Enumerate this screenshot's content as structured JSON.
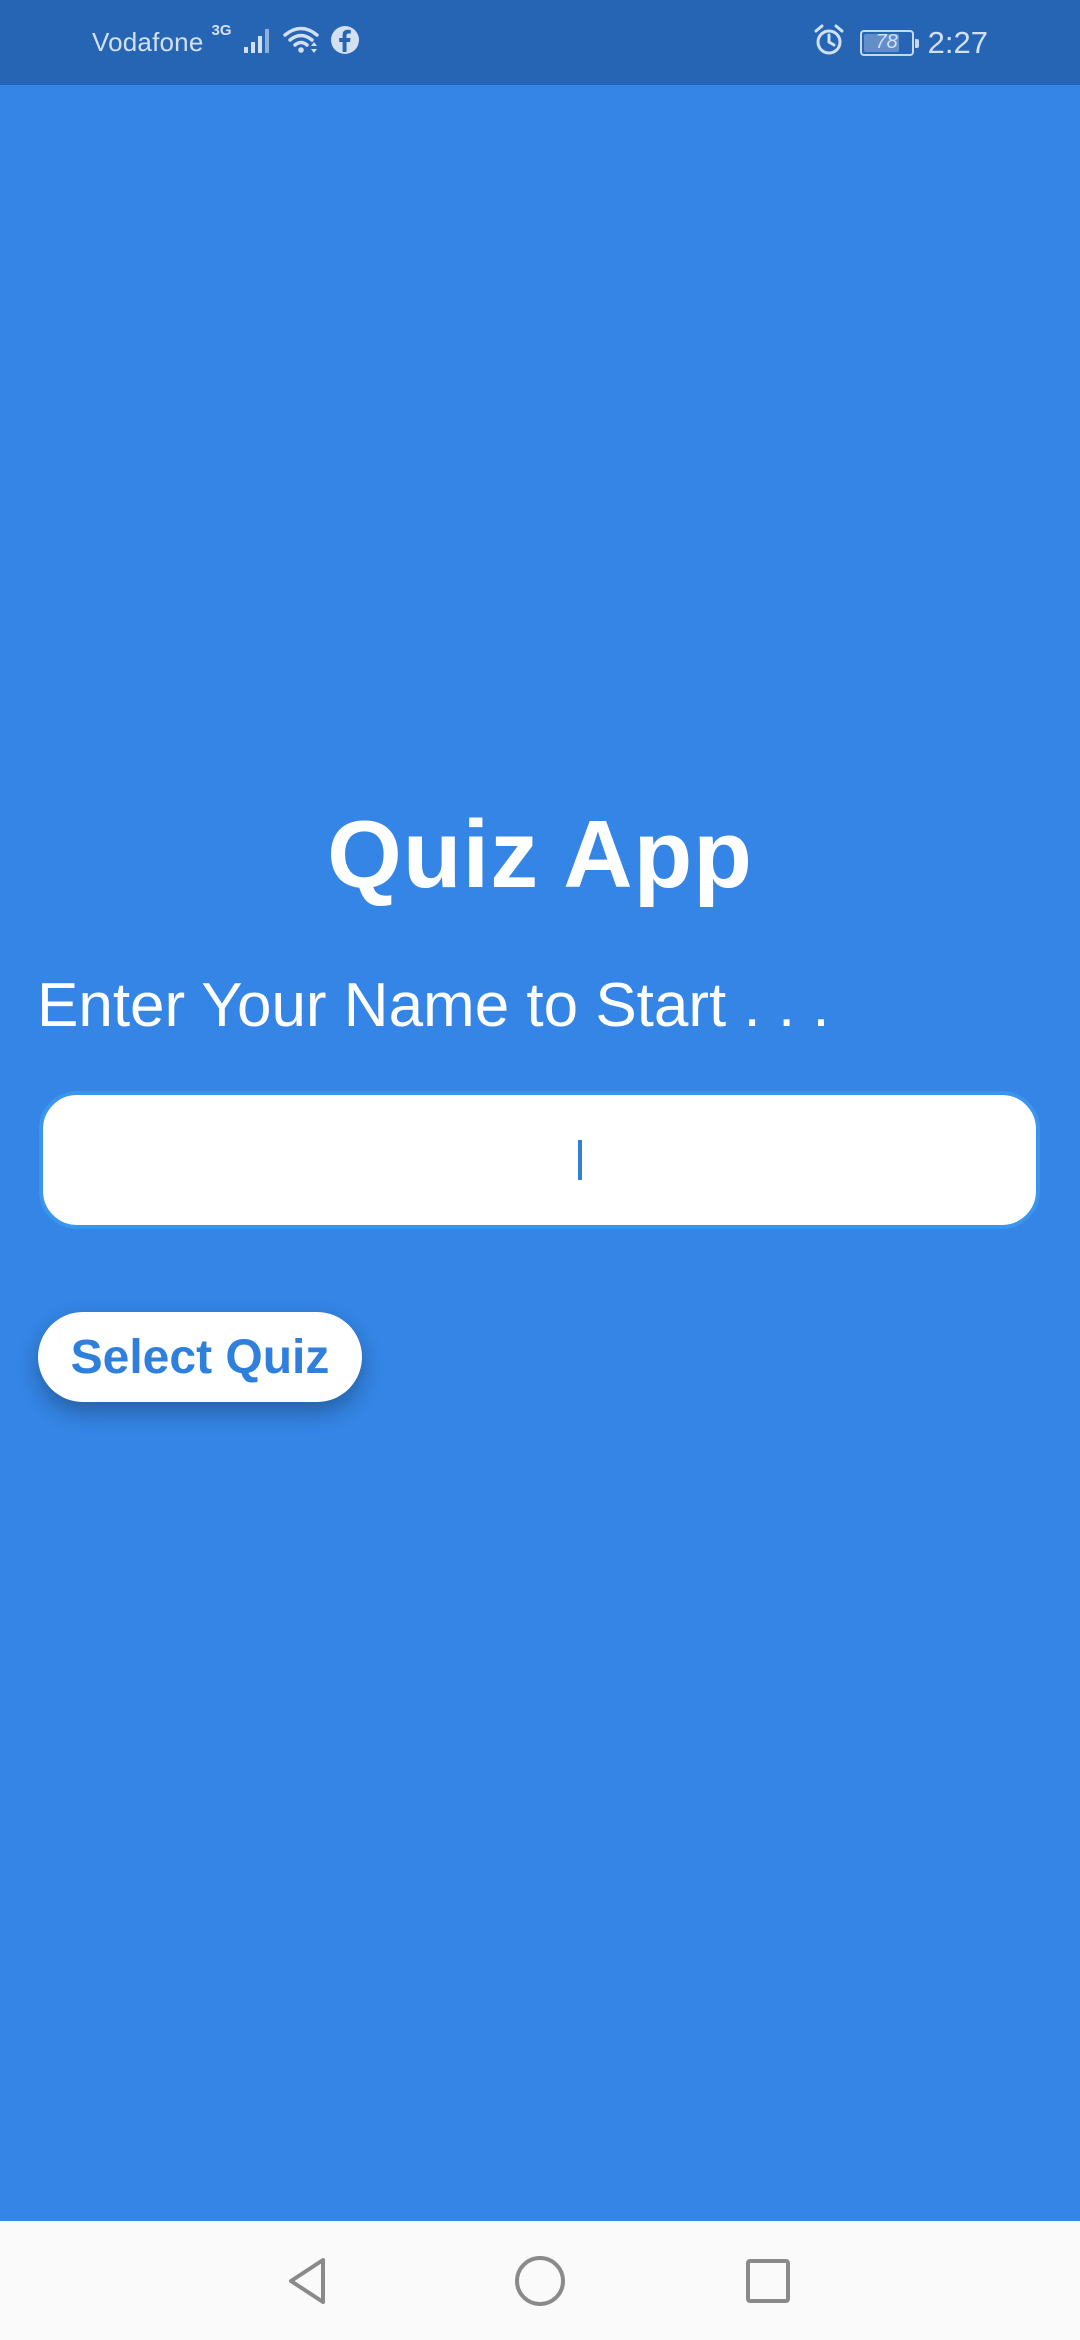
{
  "status_bar": {
    "carrier": "Vodafone",
    "network_type": "3G",
    "icons": [
      "signal-icon",
      "wifi-icon",
      "facebook-icon",
      "alarm-icon",
      "battery-icon"
    ],
    "battery_percent": "78",
    "battery_level": 0.78,
    "time": "2:27"
  },
  "main": {
    "title": "Quiz App",
    "prompt": "Enter Your Name to Start . . .",
    "name_input": {
      "value": "",
      "placeholder": ""
    },
    "select_quiz_label": "Select Quiz"
  },
  "nav_bar": {
    "buttons": [
      "back-icon",
      "home-icon",
      "recents-icon"
    ]
  },
  "colors": {
    "background": "#3485e5",
    "status_bar": "#2565b3",
    "accent": "#2f7fdc",
    "input_border": "#3a95ee",
    "surface": "#ffffff",
    "nav_bar": "#fafafa"
  }
}
